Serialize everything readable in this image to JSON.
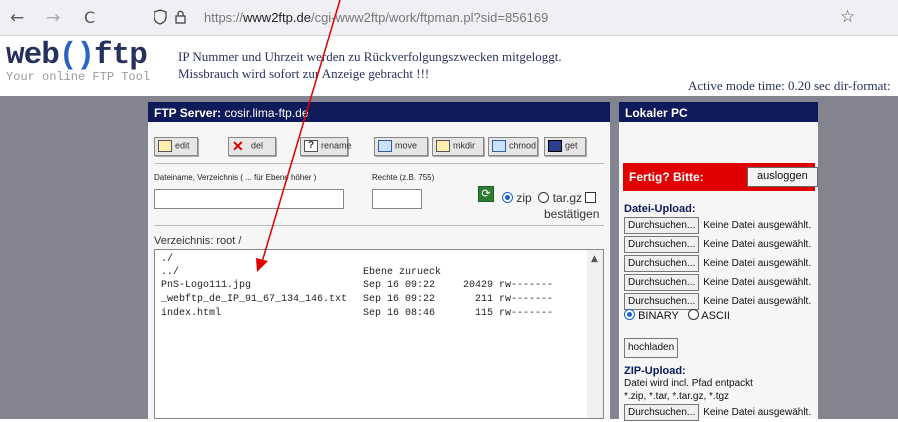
{
  "browser": {
    "back": "←",
    "forward": "→",
    "reload": "C",
    "url_prefix": "https://",
    "url_host": "www2ftp.de",
    "url_path": "/cgi-www2ftp/work/ftpman.pl?sid=856169",
    "icon_names": [
      "back-arrow-icon",
      "forward-arrow-icon",
      "reload-icon",
      "shield-icon",
      "lock-icon",
      "bookmark-star-icon"
    ]
  },
  "header": {
    "logo_part1": "web",
    "logo_part2": "()",
    "logo_part3": "ftp",
    "tagline": "Your online FTP Tool",
    "notice_line1": "IP Nummer und Uhrzeit werden zu Rückverfolgungszwecken mitgeloggt.",
    "notice_line2": "Missbrauch wird sofort zur Anzeige gebracht !!!",
    "status": "Active mode   time: 0.20 sec  dir-format:"
  },
  "ftp_panel": {
    "title_label": "FTP Server:",
    "server": "cosir.lima-ftp.de",
    "toolbar": {
      "edit": "edit",
      "del": "del",
      "rename": "rename",
      "move": "move",
      "mkdir": "mkdir",
      "chmod": "chmod",
      "get": "get"
    },
    "filename_label": "Dateiname, Verzeichnis ( ... für Ebene höher )",
    "rights_label": "Rechte (z.B. 755)",
    "zip_label": "zip",
    "targz_label": "tar.gz",
    "confirm_label": "bestätigen",
    "directory_label": "Verzeichnis:  root /",
    "files": [
      {
        "name": "./",
        "date": "",
        "size": "",
        "perms": ""
      },
      {
        "name": "../",
        "date": "Ebene zurueck",
        "size": "",
        "perms": ""
      },
      {
        "name": "PnS-Logo111.jpg",
        "date": "Sep 16 09:22",
        "size": "20429",
        "perms": "rw-------"
      },
      {
        "name": "_webftp_de_IP_91_67_134_146.txt",
        "date": "Sep 16 09:22",
        "size": "211",
        "perms": "rw-------"
      },
      {
        "name": "index.html",
        "date": "Sep 16 08:46",
        "size": "115",
        "perms": "rw-------"
      }
    ]
  },
  "local_panel": {
    "title": "Lokaler PC",
    "fertig": "Fertig? Bitte:",
    "logout": "ausloggen",
    "upload_title": "Datei-Upload:",
    "browse": "Durchsuchen...",
    "no_file": "Keine Datei ausgewählt.",
    "upload_rows": 5,
    "binary": "BINARY",
    "ascii": "ASCII",
    "upload_button": "hochladen",
    "zip_title": "ZIP-Upload:",
    "zip_note1": "Datei wird incl. Pfad entpackt",
    "zip_note2": "*.zip, *.tar, *.tar.gz, *.tgz"
  },
  "colors": {
    "panel_header": "#0e1a5a",
    "background": "#848490",
    "alert_red": "#e00000",
    "annotation_arrow": "#e00000"
  }
}
